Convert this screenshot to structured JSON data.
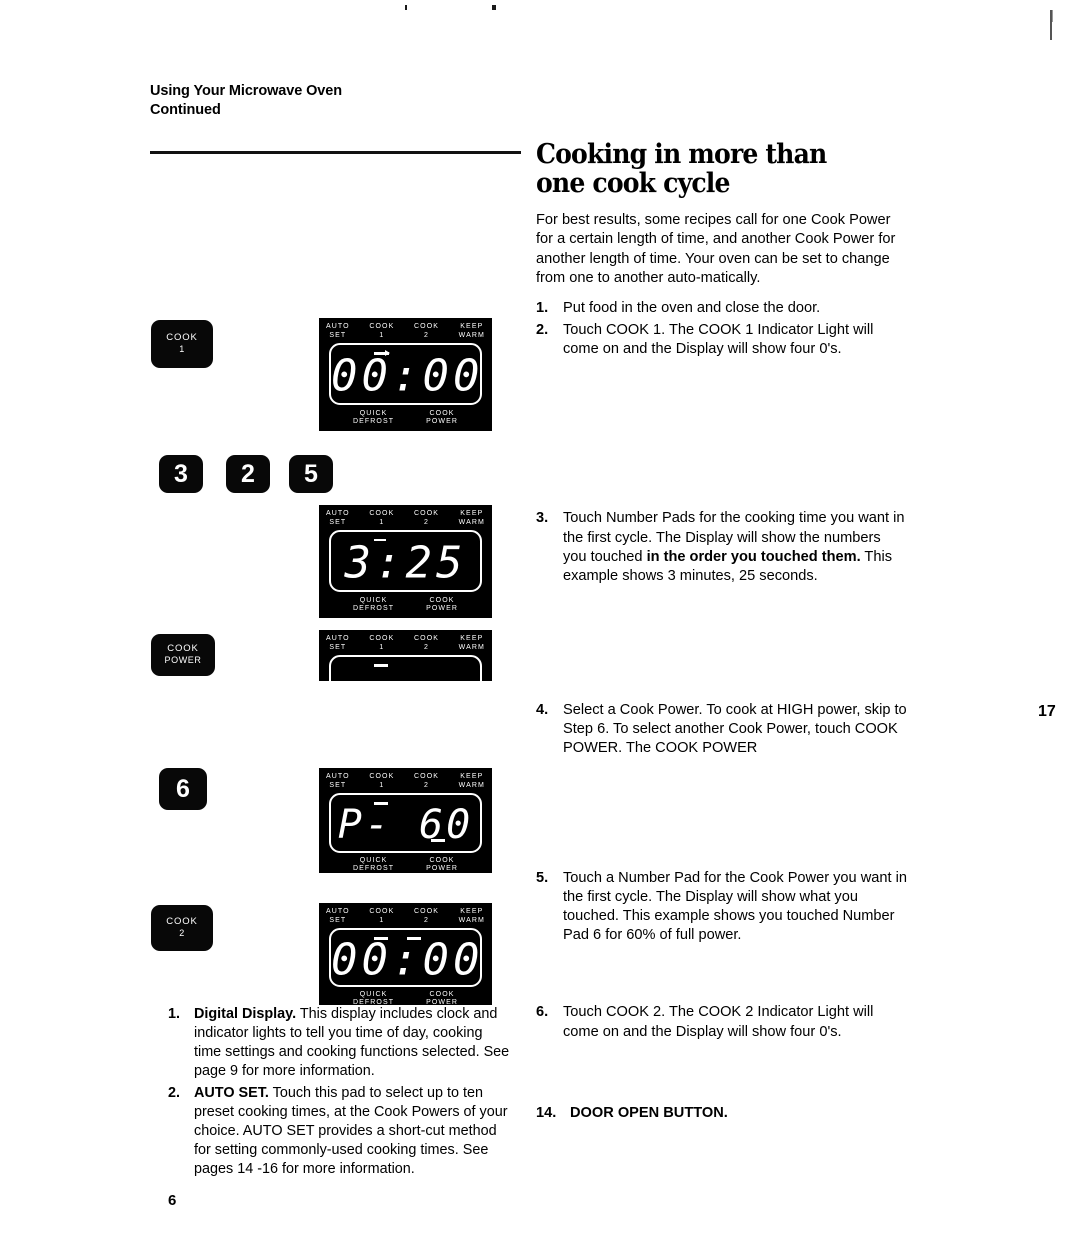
{
  "document": {
    "header_line1": "Using Your Microwave Oven",
    "header_line2": "Continued",
    "page_number": "6",
    "stray_page_number": "17"
  },
  "section": {
    "title": "Cooking in more than one cook cycle",
    "intro": "For best results, some recipes call for one Cook Power for a certain length of time, and another Cook Power for another length of time. Your oven can be set to change from one to another auto-matically."
  },
  "steps": [
    {
      "num": "1.",
      "text": "Put food in the oven and close the door."
    },
    {
      "num": "2.",
      "text": "Touch COOK 1. The COOK 1 Indicator Light will come on and the Display will show four 0's."
    },
    {
      "num": "3.",
      "pre": "Touch Number Pads for the cooking time you want in the first cycle. The Display will show the numbers you touched ",
      "bold": "in the order you touched them.",
      "post": " This example shows 3 minutes, 25 seconds."
    },
    {
      "num": "4.",
      "text": "Select a Cook Power. To cook at HIGH power, skip to Step 6. To select another Cook Power, touch COOK POWER. The COOK POWER"
    },
    {
      "num": "5.",
      "text": "Touch a Number Pad for the Cook Power you want in the first cycle. The Display will show what you touched. This example shows you touched Number Pad 6 for 60% of full power."
    },
    {
      "num": "6.",
      "text": "Touch COOK 2. The COOK 2 Indicator Light will come on and the Display will show four 0's."
    }
  ],
  "door_open_item": {
    "num": "14.",
    "text": "DOOR OPEN BUTTON."
  },
  "feature_list": [
    {
      "num": "1.",
      "bold": "Digital Display.",
      "text": " This display includes clock and indicator lights to tell you time of day, cooking time settings and cooking functions selected. See page 9 for more information."
    },
    {
      "num": "2.",
      "bold": "AUTO SET.",
      "text": " Touch this pad to select up to ten preset cooking times, at the Cook Powers of your choice. AUTO SET provides a short-cut method for setting commonly-used cooking times. See pages 14 -16 for more information."
    }
  ],
  "pads": [
    {
      "id": "cook-1",
      "line1": "COOK",
      "line2": "1"
    },
    {
      "id": "number-3",
      "line1": "3"
    },
    {
      "id": "number-2",
      "line1": "2"
    },
    {
      "id": "number-5",
      "line1": "5"
    },
    {
      "id": "cook-power",
      "line1": "COOK",
      "line2": "POWER"
    },
    {
      "id": "number-6",
      "line1": "6"
    },
    {
      "id": "cook-2",
      "line1": "COOK",
      "line2": "2"
    }
  ],
  "panel_labels": {
    "auto_set": "AUTO\nSET",
    "cook_1": "COOK\n1",
    "cook_2": "COOK\n2",
    "keep_warm": "KEEP\nWARM",
    "quick_defrost": "QUICK\nDEFROST",
    "cook_power": "COOK\nPOWER"
  },
  "displays": [
    {
      "id": "display-cook1-zeros",
      "value": "00:00"
    },
    {
      "id": "display-time-325",
      "value": "3:25"
    },
    {
      "id": "display-cook-power-clipped",
      "value": ""
    },
    {
      "id": "display-power-60",
      "value": "P- 60"
    },
    {
      "id": "display-cook2-zeros",
      "value": "00:00"
    }
  ],
  "colors": {
    "panel_background": "#000000",
    "lcd_segment": "#ffffff",
    "page_background": "#ffffff",
    "ink": "#000000"
  }
}
